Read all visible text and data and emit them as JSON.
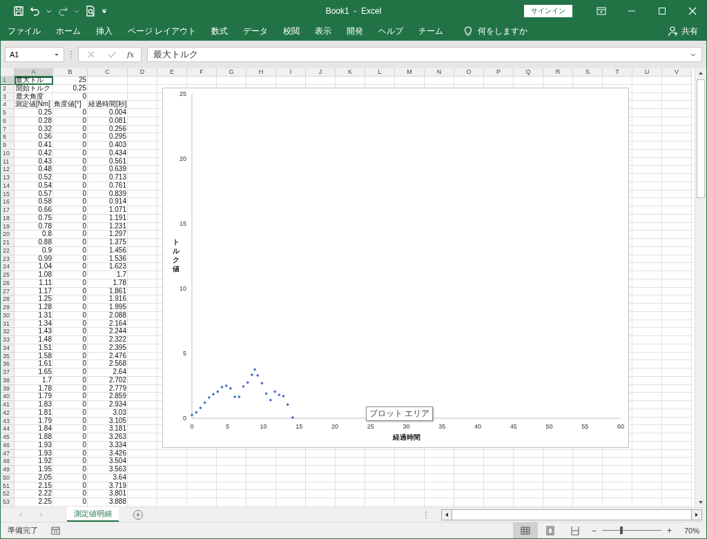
{
  "window": {
    "title": "Book1  -  Excel",
    "sign_in": "サインイン"
  },
  "ribbon_tabs": [
    {
      "label": "ファイル"
    },
    {
      "label": "ホーム"
    },
    {
      "label": "挿入"
    },
    {
      "label": "ページ レイアウト"
    },
    {
      "label": "数式"
    },
    {
      "label": "データ"
    },
    {
      "label": "校閲"
    },
    {
      "label": "表示"
    },
    {
      "label": "開発"
    },
    {
      "label": "ヘルプ"
    },
    {
      "label": "チーム"
    }
  ],
  "tell_me": "何をしますか",
  "share": "共有",
  "formula_bar": {
    "name_box": "A1",
    "fx": "fx",
    "value": "最大トルク"
  },
  "columns": [
    {
      "label": "A",
      "selected": true
    },
    {
      "label": "B",
      "selected": false
    },
    {
      "label": "C",
      "selected": false
    },
    {
      "label": "D",
      "selected": false
    },
    {
      "label": "E",
      "selected": false
    },
    {
      "label": "F",
      "selected": false
    },
    {
      "label": "G",
      "selected": false
    },
    {
      "label": "H",
      "selected": false
    },
    {
      "label": "I",
      "selected": false
    },
    {
      "label": "J",
      "selected": false
    },
    {
      "label": "K",
      "selected": false
    },
    {
      "label": "L",
      "selected": false
    },
    {
      "label": "M",
      "selected": false
    },
    {
      "label": "N",
      "selected": false
    },
    {
      "label": "O",
      "selected": false
    },
    {
      "label": "P",
      "selected": false
    },
    {
      "label": "Q",
      "selected": false
    },
    {
      "label": "R",
      "selected": false
    },
    {
      "label": "S",
      "selected": false
    },
    {
      "label": "T",
      "selected": false
    },
    {
      "label": "U",
      "selected": false
    },
    {
      "label": "V",
      "selected": false
    }
  ],
  "rows": [
    {
      "number": "1",
      "kind": "label",
      "selected": true,
      "a": "最大トル",
      "b": "25"
    },
    {
      "number": "2",
      "kind": "label",
      "selected": false,
      "a": "開始トルク",
      "b": "0.25"
    },
    {
      "number": "3",
      "kind": "label",
      "selected": false,
      "a": "最大角度",
      "b": "0"
    },
    {
      "number": "4",
      "kind": "header",
      "selected": false,
      "a": "測定値[Nm]",
      "b": "角度値[°]",
      "c": "経過時間[秒]"
    },
    {
      "number": "5",
      "kind": "data",
      "selected": false,
      "a": "0.25",
      "b": "0",
      "c": "0.004"
    },
    {
      "number": "6",
      "kind": "data",
      "selected": false,
      "a": "0.28",
      "b": "0",
      "c": "0.081"
    },
    {
      "number": "7",
      "kind": "data",
      "selected": false,
      "a": "0.32",
      "b": "0",
      "c": "0.256"
    },
    {
      "number": "8",
      "kind": "data",
      "selected": false,
      "a": "0.36",
      "b": "0",
      "c": "0.295"
    },
    {
      "number": "9",
      "kind": "data",
      "selected": false,
      "a": "0.41",
      "b": "0",
      "c": "0.403"
    },
    {
      "number": "10",
      "kind": "data",
      "selected": false,
      "a": "0.42",
      "b": "0",
      "c": "0.434"
    },
    {
      "number": "11",
      "kind": "data",
      "selected": false,
      "a": "0.43",
      "b": "0",
      "c": "0.561"
    },
    {
      "number": "12",
      "kind": "data",
      "selected": false,
      "a": "0.48",
      "b": "0",
      "c": "0.639"
    },
    {
      "number": "13",
      "kind": "data",
      "selected": false,
      "a": "0.52",
      "b": "0",
      "c": "0.713"
    },
    {
      "number": "14",
      "kind": "data",
      "selected": false,
      "a": "0.54",
      "b": "0",
      "c": "0.761"
    },
    {
      "number": "15",
      "kind": "data",
      "selected": false,
      "a": "0.57",
      "b": "0",
      "c": "0.839"
    },
    {
      "number": "16",
      "kind": "data",
      "selected": false,
      "a": "0.58",
      "b": "0",
      "c": "0.914"
    },
    {
      "number": "17",
      "kind": "data",
      "selected": false,
      "a": "0.66",
      "b": "0",
      "c": "1.071"
    },
    {
      "number": "18",
      "kind": "data",
      "selected": false,
      "a": "0.75",
      "b": "0",
      "c": "1.191"
    },
    {
      "number": "19",
      "kind": "data",
      "selected": false,
      "a": "0.78",
      "b": "0",
      "c": "1.231"
    },
    {
      "number": "20",
      "kind": "data",
      "selected": false,
      "a": "0.8",
      "b": "0",
      "c": "1.297"
    },
    {
      "number": "21",
      "kind": "data",
      "selected": false,
      "a": "0.88",
      "b": "0",
      "c": "1.375"
    },
    {
      "number": "22",
      "kind": "data",
      "selected": false,
      "a": "0.9",
      "b": "0",
      "c": "1.456"
    },
    {
      "number": "23",
      "kind": "data",
      "selected": false,
      "a": "0.99",
      "b": "0",
      "c": "1.536"
    },
    {
      "number": "24",
      "kind": "data",
      "selected": false,
      "a": "1.04",
      "b": "0",
      "c": "1.623"
    },
    {
      "number": "25",
      "kind": "data",
      "selected": false,
      "a": "1.08",
      "b": "0",
      "c": "1.7"
    },
    {
      "number": "26",
      "kind": "data",
      "selected": false,
      "a": "1.11",
      "b": "0",
      "c": "1.78"
    },
    {
      "number": "27",
      "kind": "data",
      "selected": false,
      "a": "1.17",
      "b": "0",
      "c": "1.861"
    },
    {
      "number": "28",
      "kind": "data",
      "selected": false,
      "a": "1.25",
      "b": "0",
      "c": "1.916"
    },
    {
      "number": "29",
      "kind": "data",
      "selected": false,
      "a": "1.28",
      "b": "0",
      "c": "1.995"
    },
    {
      "number": "30",
      "kind": "data",
      "selected": false,
      "a": "1.31",
      "b": "0",
      "c": "2.088"
    },
    {
      "number": "31",
      "kind": "data",
      "selected": false,
      "a": "1.34",
      "b": "0",
      "c": "2.164"
    },
    {
      "number": "32",
      "kind": "data",
      "selected": false,
      "a": "1.43",
      "b": "0",
      "c": "2.244"
    },
    {
      "number": "33",
      "kind": "data",
      "selected": false,
      "a": "1.48",
      "b": "0",
      "c": "2.322"
    },
    {
      "number": "34",
      "kind": "data",
      "selected": false,
      "a": "1.51",
      "b": "0",
      "c": "2.395"
    },
    {
      "number": "35",
      "kind": "data",
      "selected": false,
      "a": "1.58",
      "b": "0",
      "c": "2.476"
    },
    {
      "number": "36",
      "kind": "data",
      "selected": false,
      "a": "1.61",
      "b": "0",
      "c": "2.568"
    },
    {
      "number": "37",
      "kind": "data",
      "selected": false,
      "a": "1.65",
      "b": "0",
      "c": "2.64"
    },
    {
      "number": "38",
      "kind": "data",
      "selected": false,
      "a": "1.7",
      "b": "0",
      "c": "2.702"
    },
    {
      "number": "39",
      "kind": "data",
      "selected": false,
      "a": "1.78",
      "b": "0",
      "c": "2.779"
    },
    {
      "number": "40",
      "kind": "data",
      "selected": false,
      "a": "1.79",
      "b": "0",
      "c": "2.859"
    },
    {
      "number": "41",
      "kind": "data",
      "selected": false,
      "a": "1.83",
      "b": "0",
      "c": "2.934"
    },
    {
      "number": "42",
      "kind": "data",
      "selected": false,
      "a": "1.81",
      "b": "0",
      "c": "3.03"
    },
    {
      "number": "43",
      "kind": "data",
      "selected": false,
      "a": "1.79",
      "b": "0",
      "c": "3.105"
    },
    {
      "number": "44",
      "kind": "data",
      "selected": false,
      "a": "1.84",
      "b": "0",
      "c": "3.181"
    },
    {
      "number": "45",
      "kind": "data",
      "selected": false,
      "a": "1.88",
      "b": "0",
      "c": "3.263"
    },
    {
      "number": "46",
      "kind": "data",
      "selected": false,
      "a": "1.93",
      "b": "0",
      "c": "3.334"
    },
    {
      "number": "47",
      "kind": "data",
      "selected": false,
      "a": "1.93",
      "b": "0",
      "c": "3.426"
    },
    {
      "number": "48",
      "kind": "data",
      "selected": false,
      "a": "1.92",
      "b": "0",
      "c": "3.504"
    },
    {
      "number": "49",
      "kind": "data",
      "selected": false,
      "a": "1.95",
      "b": "0",
      "c": "3.563"
    },
    {
      "number": "50",
      "kind": "data",
      "selected": false,
      "a": "2.05",
      "b": "0",
      "c": "3.64"
    },
    {
      "number": "51",
      "kind": "data",
      "selected": false,
      "a": "2.15",
      "b": "0",
      "c": "3.719"
    },
    {
      "number": "52",
      "kind": "data",
      "selected": false,
      "a": "2.22",
      "b": "0",
      "c": "3.801"
    },
    {
      "number": "53",
      "kind": "data",
      "selected": false,
      "a": "2.25",
      "b": "0",
      "c": "3.888"
    }
  ],
  "chart": {
    "tooltip": "プロット エリア",
    "chart_data": {
      "type": "scatter",
      "xlabel": "経過時間",
      "ylabel": "トルク値",
      "xlim": [
        0,
        60
      ],
      "ylim": [
        0,
        25
      ],
      "xticks": [
        0,
        5,
        10,
        15,
        20,
        25,
        30,
        35,
        40,
        45,
        50,
        55,
        60
      ],
      "yticks": [
        0,
        5,
        10,
        15,
        20,
        25
      ],
      "x": [
        0,
        0.6,
        1.2,
        1.8,
        2.4,
        3,
        3.6,
        4.2,
        4.8,
        5.4,
        6,
        6.6,
        7.2,
        7.8,
        8.4,
        8.8,
        9.2,
        9.8,
        10.4,
        11,
        11.6,
        12.2,
        12.8,
        13.4,
        14.1
      ],
      "series": [
        {
          "color": "#4472c4",
          "values": [
            0.25,
            0.45,
            0.8,
            1.2,
            1.6,
            1.85,
            2.05,
            2.4,
            2.5,
            2.3,
            1.65,
            1.65,
            2.45,
            2.75,
            3.35,
            3.75,
            3.3,
            2.7,
            1.9,
            1.4,
            2.05,
            1.8,
            1.7,
            1.05,
            0.05
          ]
        }
      ]
    }
  },
  "sheet_tabs": [
    {
      "label": "測定値明細",
      "selected": true
    }
  ],
  "status": {
    "text": "準備完了",
    "views": [
      {
        "selected": true
      },
      {
        "selected": false
      },
      {
        "selected": false
      }
    ],
    "zoom": {
      "level": 0.33,
      "reading": "70%"
    },
    "minus": "−",
    "plus": "+"
  }
}
